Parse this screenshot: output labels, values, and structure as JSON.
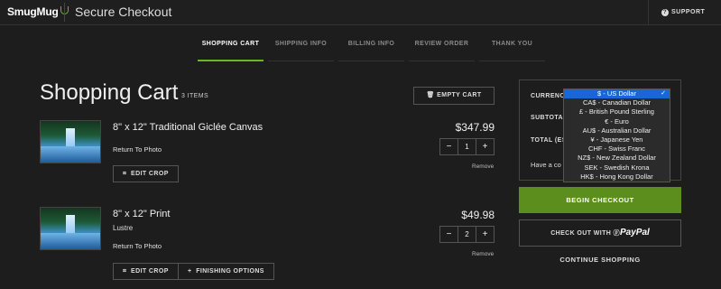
{
  "header": {
    "logo": "SmugMug",
    "title": "Secure Checkout",
    "support": "SUPPORT"
  },
  "steps": [
    {
      "label": "SHOPPING CART"
    },
    {
      "label": "SHIPPING INFO"
    },
    {
      "label": "BILLING INFO"
    },
    {
      "label": "REVIEW ORDER"
    },
    {
      "label": "THANK YOU"
    }
  ],
  "cart": {
    "title": "Shopping Cart",
    "count": "3 ITEMS",
    "empty_label": "EMPTY CART"
  },
  "items": [
    {
      "name": "8\" x 12\" Traditional Giclée Canvas",
      "return_link": "Return To Photo",
      "edit_crop": "EDIT CROP",
      "price": "$347.99",
      "qty": "1",
      "remove": "Remove"
    },
    {
      "name": "8\" x 12\" Print",
      "sub": "Lustre",
      "return_link": "Return To Photo",
      "edit_crop": "EDIT CROP",
      "finishing": "FINISHING OPTIONS",
      "price": "$49.98",
      "qty": "2",
      "remove": "Remove"
    }
  ],
  "summary": {
    "currency_label": "CURRENCY",
    "subtotal_label": "SUBTOTAL",
    "total_label": "TOTAL (ES",
    "coupon_text": "Have a co",
    "currency_options": [
      "$ - US Dollar",
      "CA$ - Canadian Dollar",
      "£ - British Pound Sterling",
      "€ - Euro",
      "AU$ - Australian Dollar",
      "¥ - Japanese Yen",
      "CHF - Swiss Franc",
      "NZ$ - New Zealand Dollar",
      "SEK - Swedish Krona",
      "HK$ - Hong Kong Dollar"
    ],
    "selected_currency": "$ - US Dollar",
    "begin_checkout": "BEGIN CHECKOUT",
    "paypal_prefix": "CHECK OUT WITH",
    "paypal_brand": "PayPal",
    "continue_shopping": "CONTINUE SHOPPING"
  },
  "colors": {
    "accent": "#6bb52d",
    "checkout_button": "#5b8e1d",
    "dropdown_selected": "#1a66d8"
  }
}
